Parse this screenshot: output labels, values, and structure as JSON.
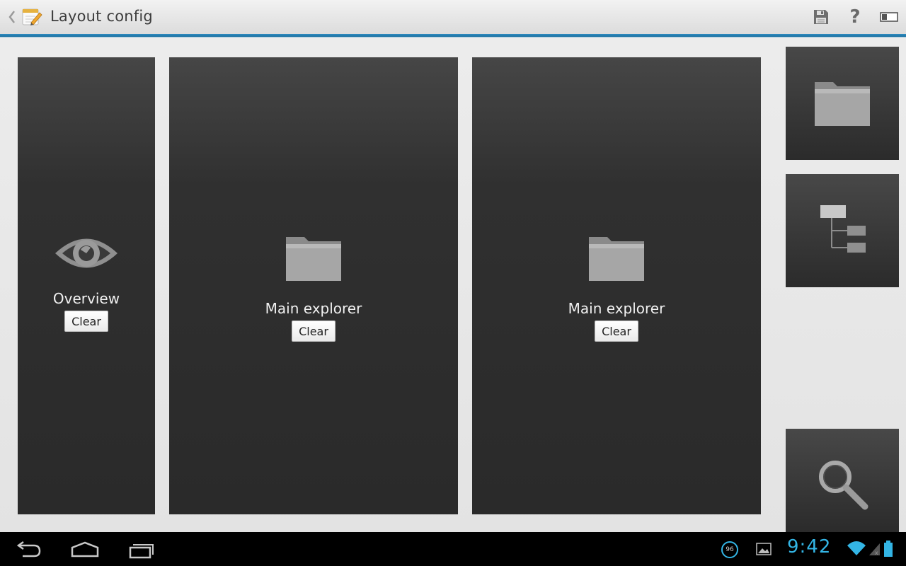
{
  "actionbar": {
    "title": "Layout config",
    "icons": [
      "back-caret",
      "notepad-app-icon",
      "save-icon",
      "help-icon",
      "toggle-panel-icon"
    ],
    "help_label": "?",
    "accent_color": "#33b5e5"
  },
  "panels": [
    {
      "label": "Overview",
      "icon": "eye-icon",
      "clear_label": "Clear"
    },
    {
      "label": "Main explorer",
      "icon": "folder-icon",
      "clear_label": "Clear"
    },
    {
      "label": "Main explorer",
      "icon": "folder-icon",
      "clear_label": "Clear"
    }
  ],
  "palette": {
    "tiles": [
      {
        "icon": "folder-icon"
      },
      {
        "icon": "tree-icon"
      },
      {
        "icon": "search-icon"
      }
    ]
  },
  "statusbar": {
    "notification_count": "96",
    "time": "9:42",
    "icons": [
      "back-icon",
      "home-icon",
      "recent-apps-icon",
      "notification-badge-icon",
      "gallery-icon",
      "wifi-icon",
      "signal-icon",
      "battery-icon"
    ]
  }
}
